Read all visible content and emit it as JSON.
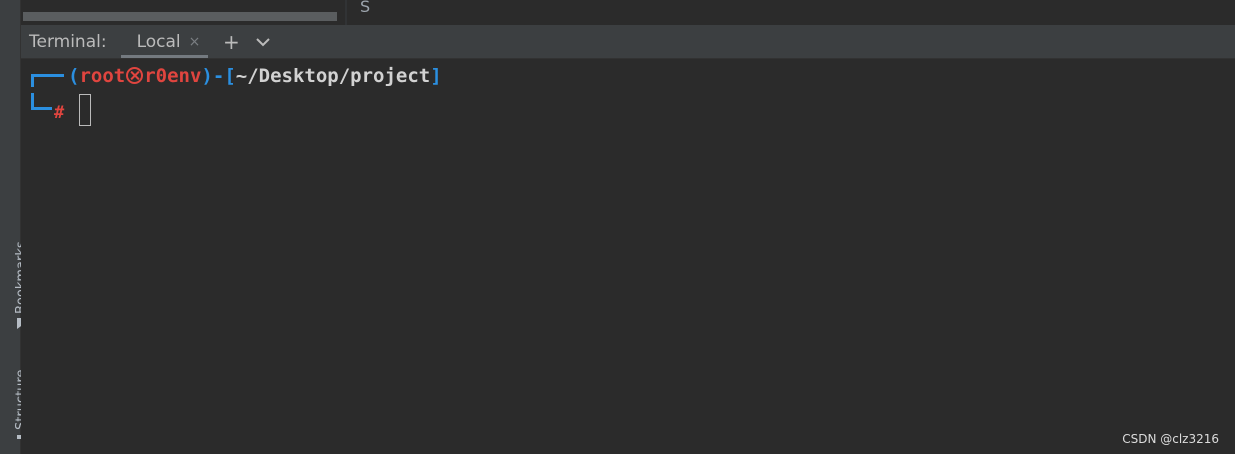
{
  "top": {
    "partial_text": "S"
  },
  "left_strip": {
    "bookmarks_label": "Bookmarks",
    "structure_label": "Structure"
  },
  "terminal_window": {
    "title": "Terminal:",
    "tab_label": "Local",
    "close_glyph": "×",
    "add_glyph": "+"
  },
  "prompt": {
    "open_paren": "(",
    "user": "root",
    "host": "r0env",
    "close_paren": ")",
    "dash": "-",
    "open_bracket": "[",
    "path": "~/Desktop/project",
    "close_bracket": "]",
    "symbol": "#"
  },
  "watermark": "CSDN @clz3216",
  "colors": {
    "prompt_blue": "#2b8fe0",
    "prompt_red": "#e0453f",
    "path_text": "#d2d2d2",
    "background": "#2b2b2b",
    "header_bg": "#3c3f41"
  }
}
